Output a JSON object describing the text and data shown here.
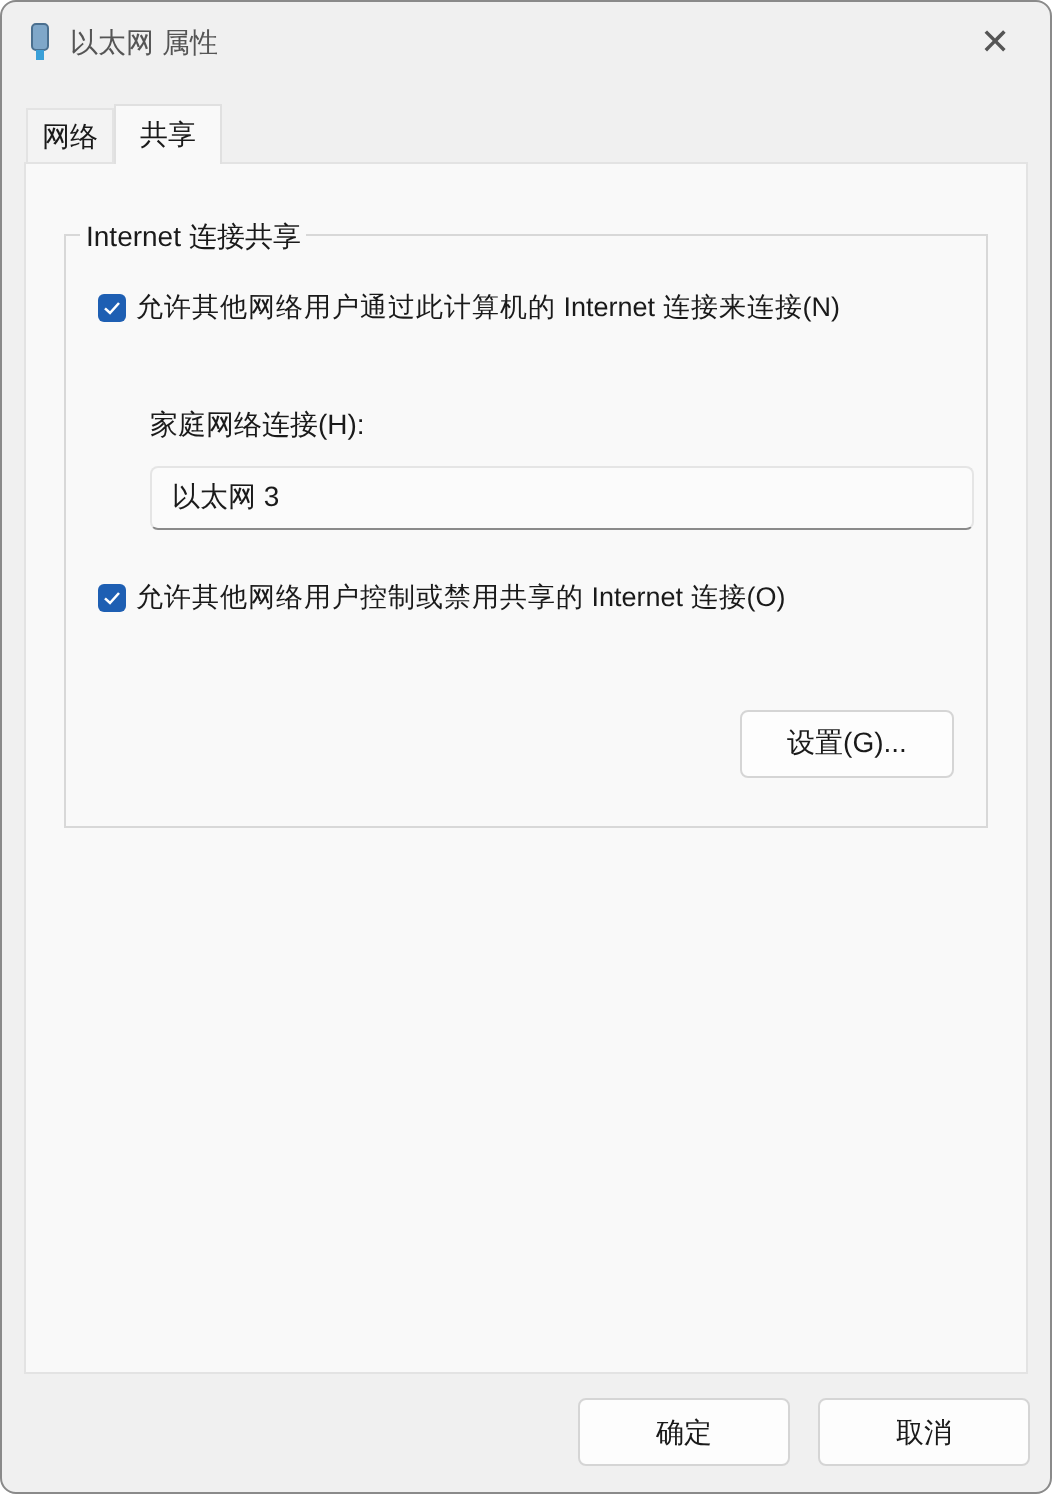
{
  "window": {
    "title": "以太网 属性",
    "close": "✕"
  },
  "tabs": [
    {
      "label": "网络",
      "selected": false
    },
    {
      "label": "共享",
      "selected": true
    }
  ],
  "group": {
    "title": "Internet 连接共享",
    "options": [
      {
        "kind": "checkbox",
        "label": "允许其他网络用户通过此计算机的 Internet 连接来连接(N)",
        "checked": true
      },
      {
        "kind": "field",
        "label": "家庭网络连接(H):",
        "value": "以太网 3"
      },
      {
        "kind": "checkbox",
        "label": "允许其他网络用户控制或禁用共享的 Internet 连接(O)",
        "checked": true
      }
    ],
    "settings_button": "设置(G)..."
  },
  "buttons": [
    "确定",
    "取消"
  ]
}
